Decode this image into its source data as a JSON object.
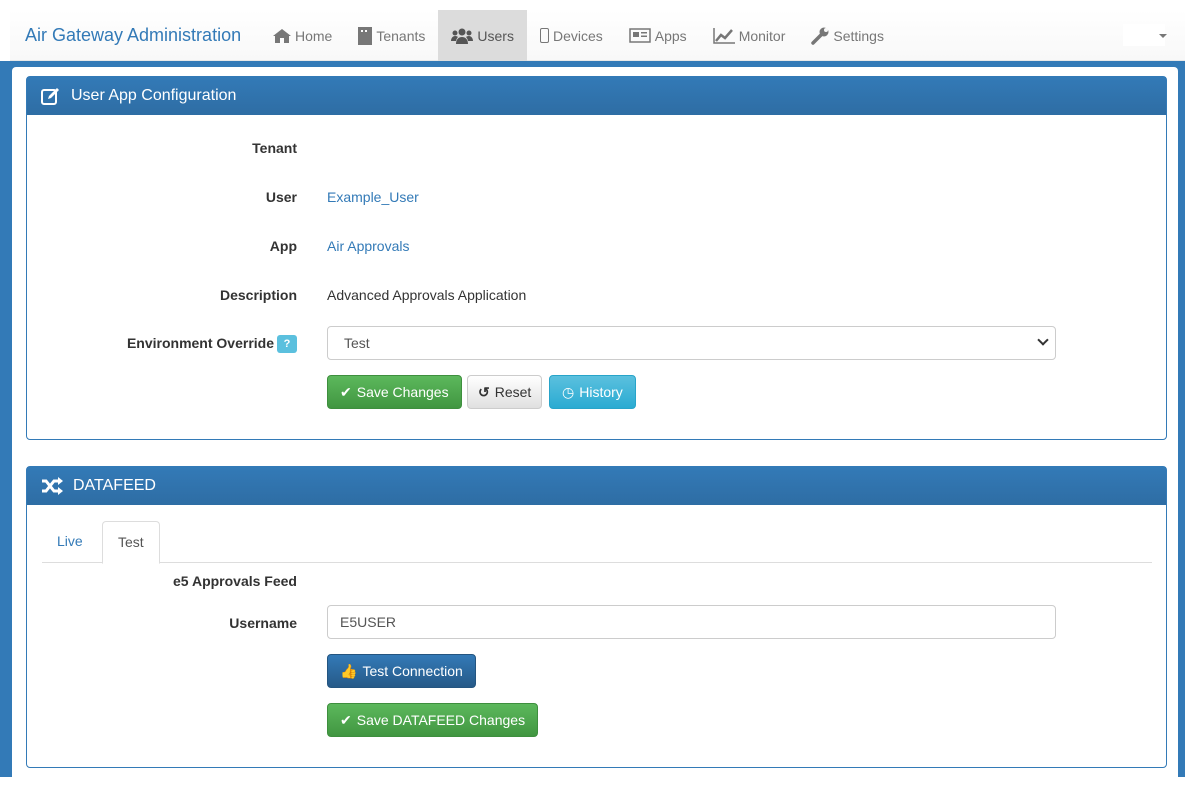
{
  "navbar": {
    "brand": "Air Gateway Administration",
    "items": [
      {
        "label": "Home",
        "icon": "home-icon"
      },
      {
        "label": "Tenants",
        "icon": "building-icon"
      },
      {
        "label": "Users",
        "icon": "users-icon",
        "active": true
      },
      {
        "label": "Devices",
        "icon": "mobile-icon"
      },
      {
        "label": "Apps",
        "icon": "newspaper-icon"
      },
      {
        "label": "Monitor",
        "icon": "line-chart-icon"
      },
      {
        "label": "Settings",
        "icon": "wrench-icon"
      }
    ]
  },
  "config": {
    "title": "User App Configuration",
    "tenant_label": "Tenant",
    "user_label": "User",
    "user_value": "Example_User",
    "app_label": "App",
    "app_value": "Air Approvals",
    "description_label": "Description",
    "description_value": "Advanced Approvals Application",
    "env_label": "Environment Override",
    "help": "?",
    "env_value": "Test",
    "save": "Save Changes",
    "reset": "Reset",
    "history": "History"
  },
  "datafeed": {
    "title": "DATAFEED",
    "tabs": [
      "Live",
      "Test"
    ],
    "active_tab": "Test",
    "feed_title": "e5 Approvals Feed",
    "username_label": "Username",
    "username_value": "E5USER",
    "test_connection": "Test Connection",
    "save": "Save DATAFEED Changes"
  }
}
